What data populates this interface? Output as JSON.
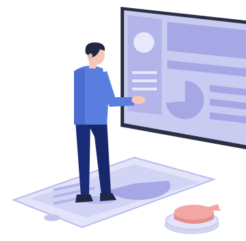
{
  "colors": {
    "background": "#ffffff",
    "board_frame": "#2b2f45",
    "board_fill": "#c9cbf0",
    "board_shapes": "#a6a8e6",
    "phone_fill": "#d9dbf7",
    "phone_screen": "#c3c5ef",
    "shirt": "#5a7de0",
    "pants": "#1a2c78",
    "skin": "#f6c7b8",
    "hair": "#1f2745",
    "shoes": "#1f2745",
    "pie_chart": "#f2a7a5",
    "pie_base": "#c9cbf0"
  },
  "icons": {
    "main": "presentation-board-illustration",
    "figure": "person-figure",
    "phone": "smartphone-illustration",
    "pie": "pie-chart-icon"
  }
}
